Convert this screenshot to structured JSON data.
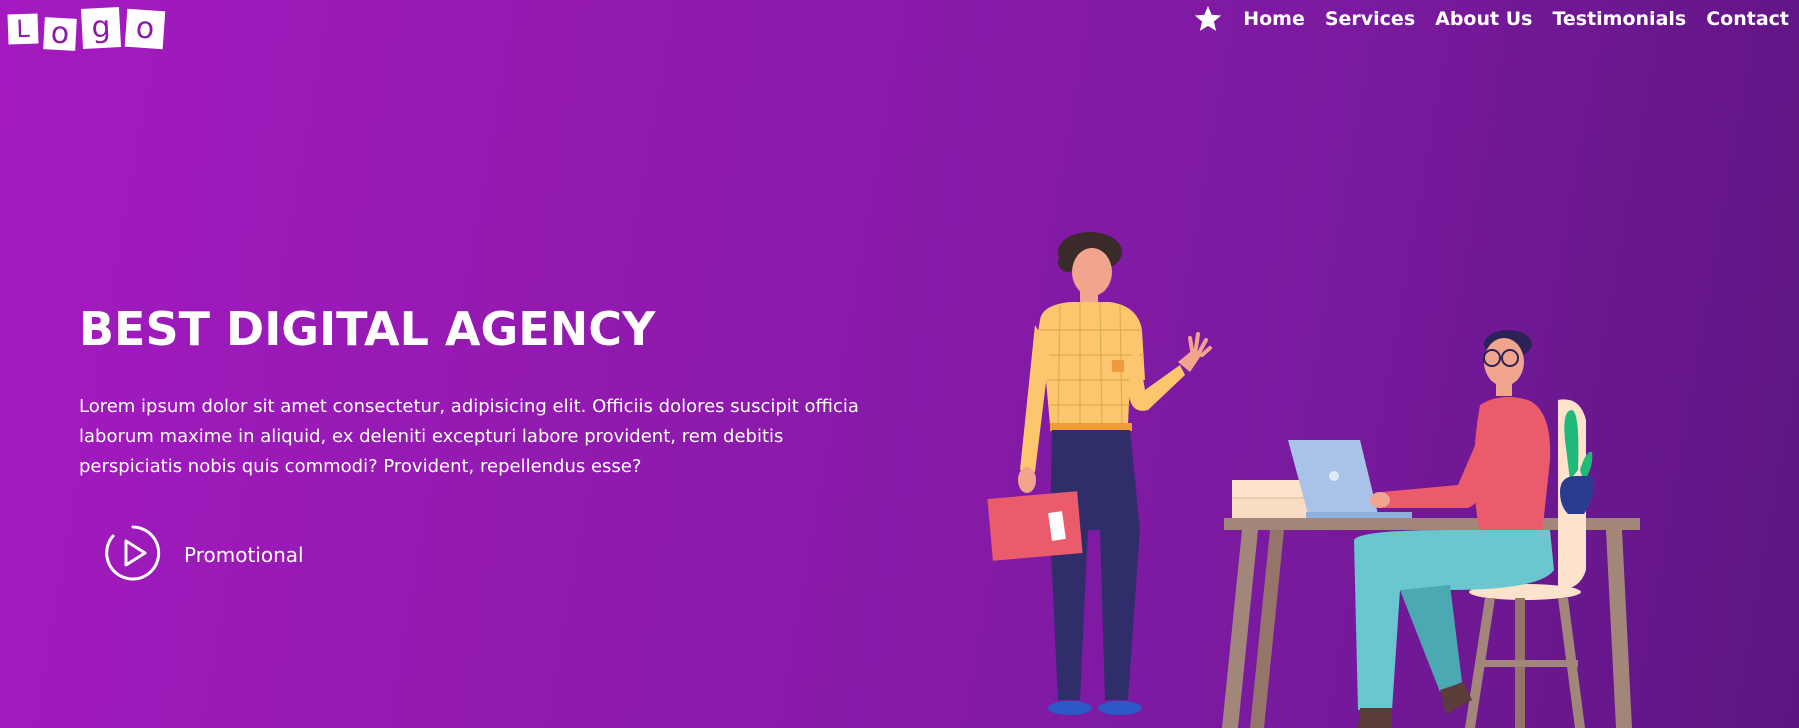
{
  "logo": {
    "letters": [
      "L",
      "o",
      "g",
      "o"
    ]
  },
  "nav": {
    "items": [
      {
        "label": "Home"
      },
      {
        "label": "Services"
      },
      {
        "label": "About Us"
      },
      {
        "label": "Testimonials"
      },
      {
        "label": "Contact"
      }
    ],
    "icon": "star-icon"
  },
  "hero": {
    "title": "BEST DIGITAL AGENCY",
    "text": "Lorem ipsum dolor sit amet consectetur, adipisicing elit. Officiis dolores suscipit officia laborum maxime in aliquid, ex deleniti excepturi labore provident, rem debitis perspiciatis nobis quis commodi? Provident, repellendus esse?",
    "promo_label": "Promotional",
    "promo_icon": "play-circle-icon"
  },
  "colors": {
    "gradient_start": "#a41ac0",
    "gradient_end": "#5c1580",
    "text": "#ffffff"
  }
}
